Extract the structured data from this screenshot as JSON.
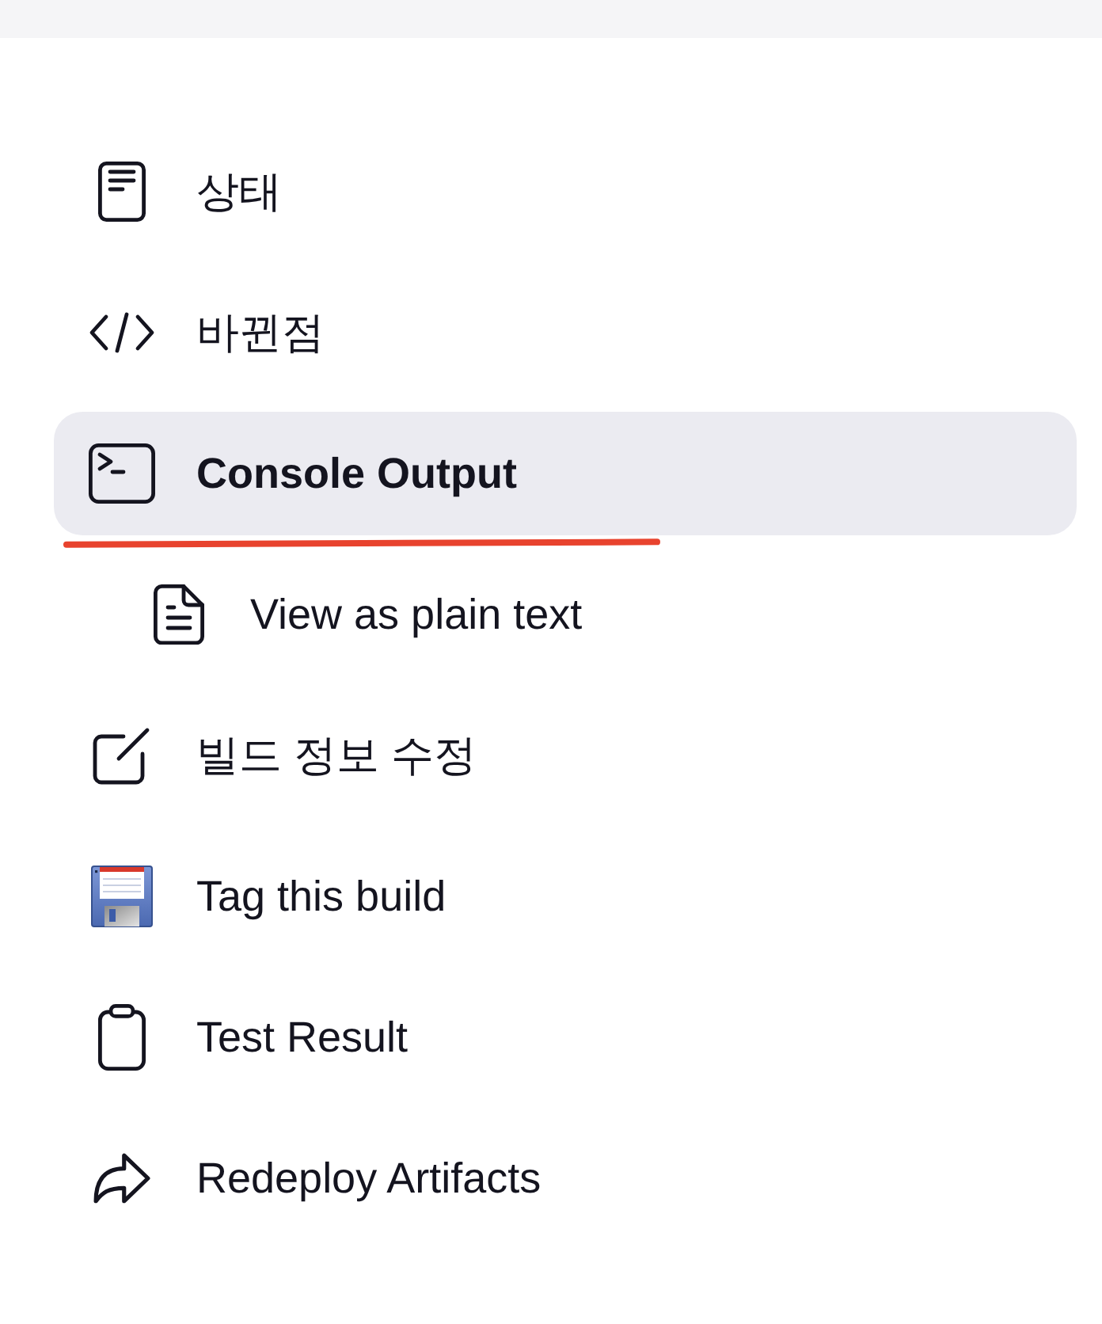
{
  "sidebar": {
    "items": [
      {
        "label": "상태",
        "selected": false,
        "underlined": false
      },
      {
        "label": "바뀐점",
        "selected": false,
        "underlined": false
      },
      {
        "label": "Console Output",
        "selected": true,
        "underlined": true,
        "children": [
          {
            "label": "View as plain text",
            "selected": false,
            "underlined": false
          }
        ]
      },
      {
        "label": "빌드 정보 수정",
        "selected": false,
        "underlined": false
      },
      {
        "label": "Tag this build",
        "selected": false,
        "underlined": false
      },
      {
        "label": "Test Result",
        "selected": false,
        "underlined": false
      },
      {
        "label": "Redeploy Artifacts",
        "selected": false,
        "underlined": false
      }
    ]
  }
}
